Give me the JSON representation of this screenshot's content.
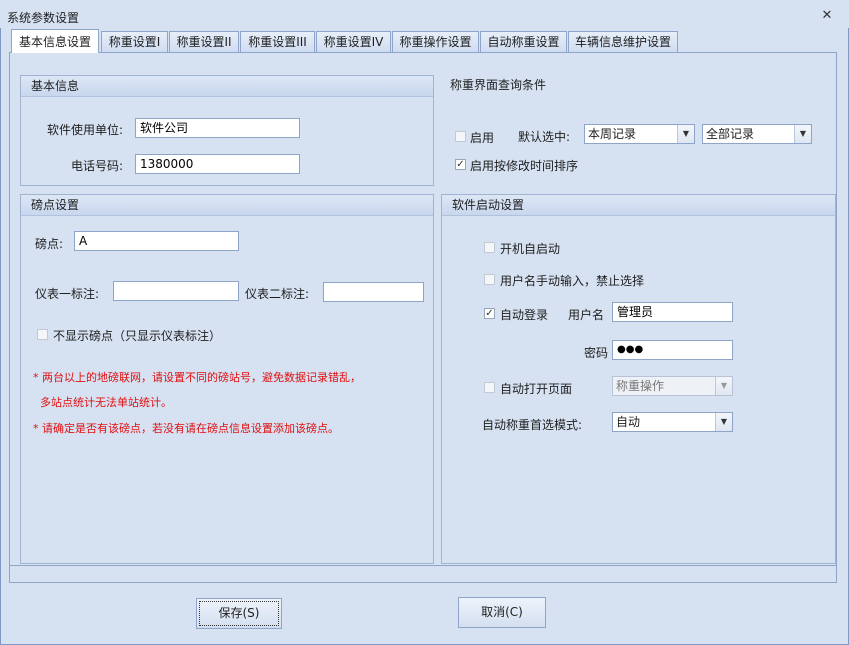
{
  "window": {
    "title": "系统参数设置",
    "close_icon": "✕"
  },
  "tabs": [
    {
      "label": "基本信息设置",
      "active": true
    },
    {
      "label": "称重设置I",
      "active": false
    },
    {
      "label": "称重设置II",
      "active": false
    },
    {
      "label": "称重设置III",
      "active": false
    },
    {
      "label": "称重设置IV",
      "active": false
    },
    {
      "label": "称重操作设置",
      "active": false
    },
    {
      "label": "自动称重设置",
      "active": false
    },
    {
      "label": "车辆信息维护设置",
      "active": false
    }
  ],
  "basic_info": {
    "header": "基本信息",
    "company_label": "软件使用单位:",
    "company_value": "软件公司",
    "phone_label": "电话号码:",
    "phone_value": "1380000"
  },
  "query_conditions": {
    "header": "称重界面查询条件",
    "enable_label": "启用",
    "enable_checked": false,
    "default_label": "默认选中:",
    "period_value": "本周记录",
    "scope_value": "全部记录",
    "sort_label": "启用按修改时间排序",
    "sort_checked": true
  },
  "weigh_point": {
    "header": "磅点设置",
    "point_label": "磅点:",
    "point_value": "A",
    "meter1_label": "仪表一标注:",
    "meter1_value": "",
    "meter2_label": "仪表二标注:",
    "meter2_value": "",
    "hide_label": "不显示磅点（只显示仪表标注）",
    "hide_checked": false,
    "note1_line1": "* 两台以上的地磅联网，请设置不同的磅站号，避免数据记录错乱，",
    "note1_line2": "多站点统计无法单站统计。",
    "note2": "* 请确定是否有该磅点，若没有请在磅点信息设置添加该磅点。"
  },
  "startup": {
    "header": "软件启动设置",
    "autostart_label": "开机自启动",
    "autostart_checked": false,
    "manual_input_label": "用户名手动输入，禁止选择",
    "manual_input_checked": false,
    "autologin_label": "自动登录",
    "autologin_checked": true,
    "username_label": "用户名",
    "username_value": "管理员",
    "password_label": "密码",
    "password_value": "●●●",
    "open_page_label": "自动打开页面",
    "open_page_checked": false,
    "open_page_value": "称重操作",
    "mode_label": "自动称重首选模式:",
    "mode_value": "自动"
  },
  "buttons": {
    "save": "保存(S)",
    "cancel": "取消(C)"
  },
  "icons": {
    "dropdown": "chevron-down-icon",
    "checkmark": "checkmark-icon",
    "close": "close-icon"
  }
}
